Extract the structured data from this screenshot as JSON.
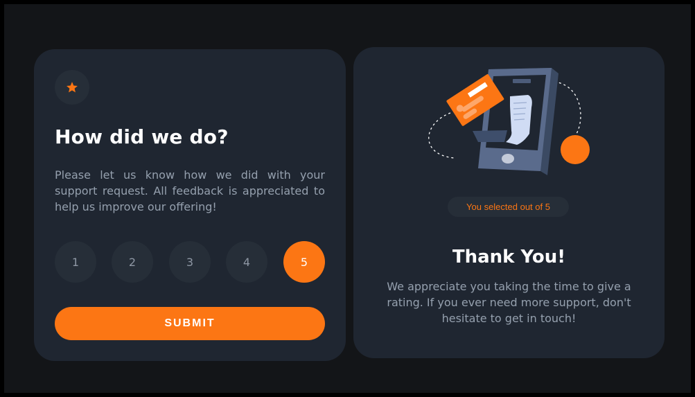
{
  "rating_card": {
    "icon": "star-icon",
    "title": "How did we do?",
    "description": "Please let us know how we did with your support request. All feedback is appreciated to help us improve our offering!",
    "ratings": [
      "1",
      "2",
      "3",
      "4",
      "5"
    ],
    "selected_rating": "5",
    "submit_label": "SUBMIT"
  },
  "thank_you_card": {
    "illustration": "payment-phone-illustration",
    "selection_text": "You selected out of 5",
    "title": "Thank You!",
    "description": "We appreciate you taking the time to give a rating. If you ever need more support, don't hesitate to get in touch!"
  },
  "colors": {
    "accent": "#fc7614",
    "card_background": "#1f2631",
    "page_background": "#131518",
    "muted_text": "#95a0ae"
  }
}
